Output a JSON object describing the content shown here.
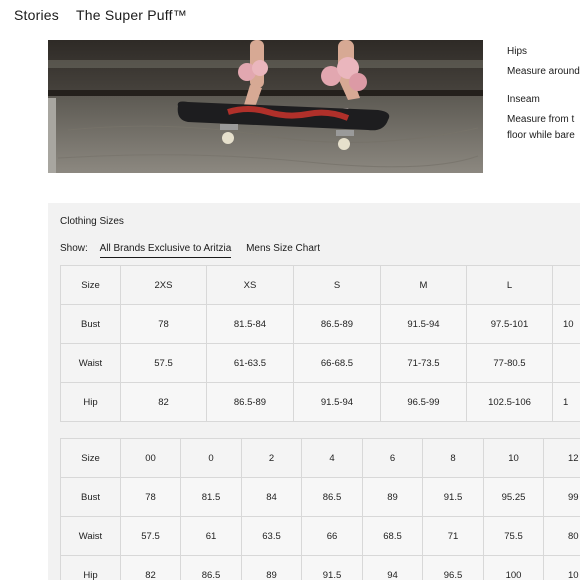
{
  "nav": {
    "stories": "Stories",
    "product": "The Super Puff™"
  },
  "measurements": [
    {
      "label": "Hips",
      "desc_lines": [
        "Measure around"
      ]
    },
    {
      "label": "Inseam",
      "desc_lines": [
        "Measure from t",
        "floor while bare"
      ]
    }
  ],
  "panel": {
    "title": "Clothing Sizes",
    "show_label": "Show:",
    "tabs": [
      "All Brands Exclusive to Aritzia",
      "Mens Size Chart"
    ]
  },
  "table1": {
    "rows": [
      {
        "label": "Size",
        "cells": [
          "2XS",
          "XS",
          "S",
          "M",
          "L",
          ""
        ]
      },
      {
        "label": "Bust",
        "cells": [
          "78",
          "81.5-84",
          "86.5-89",
          "91.5-94",
          "97.5-101",
          "10"
        ]
      },
      {
        "label": "Waist",
        "cells": [
          "57.5",
          "61-63.5",
          "66-68.5",
          "71-73.5",
          "77-80.5",
          ""
        ]
      },
      {
        "label": "Hip",
        "cells": [
          "82",
          "86.5-89",
          "91.5-94",
          "96.5-99",
          "102.5-106",
          "1"
        ]
      }
    ]
  },
  "table2": {
    "rows": [
      {
        "label": "Size",
        "cells": [
          "00",
          "0",
          "2",
          "4",
          "6",
          "8",
          "10",
          "12"
        ]
      },
      {
        "label": "Bust",
        "cells": [
          "78",
          "81.5",
          "84",
          "86.5",
          "89",
          "91.5",
          "95.25",
          "99"
        ]
      },
      {
        "label": "Waist",
        "cells": [
          "57.5",
          "61",
          "63.5",
          "66",
          "68.5",
          "71",
          "75.5",
          "80"
        ]
      },
      {
        "label": "Hip",
        "cells": [
          "82",
          "86.5",
          "89",
          "91.5",
          "94",
          "96.5",
          "100",
          "10"
        ]
      }
    ]
  }
}
